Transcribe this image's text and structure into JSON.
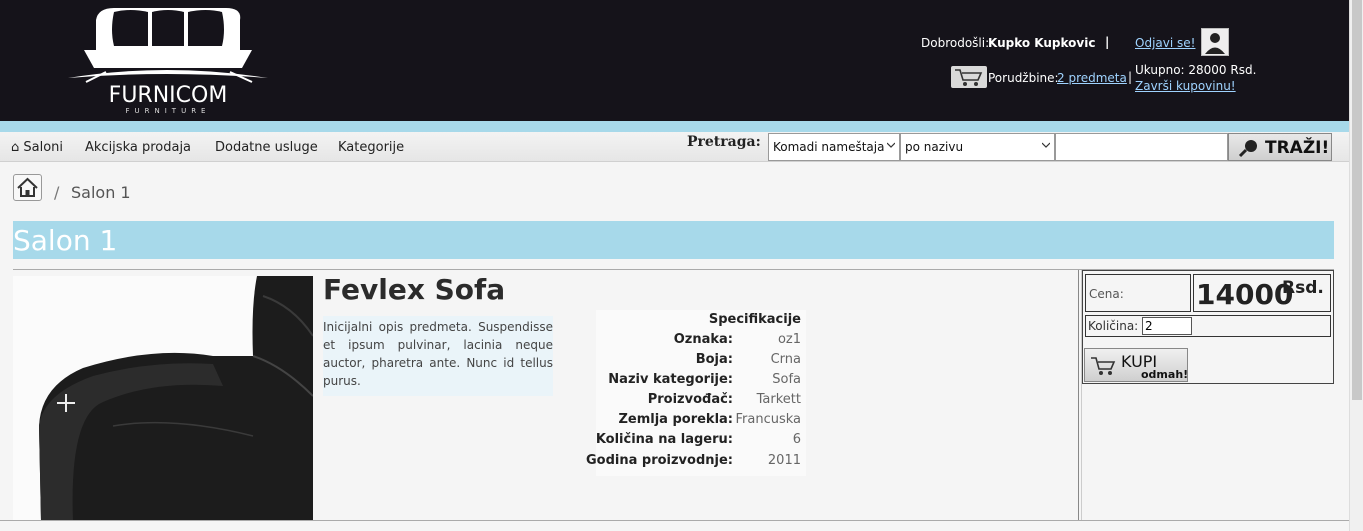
{
  "header": {
    "logo": {
      "brand": "FURNICOM",
      "tagline": "FURNITURE"
    },
    "welcome_label": "Dobrodošli:",
    "user_name": "Kupko Kupkovic",
    "separator": "|",
    "logout_link": "Odjavi se!",
    "orders_label": "Porudžbine:",
    "orders_link": "2 predmeta",
    "total_label": "Ukupno: 28000 Rsd.",
    "checkout_link": "Završi kupovinu!",
    "icons": {
      "avatar": "user-avatar-icon",
      "cart": "shopping-cart-icon"
    }
  },
  "nav": {
    "items": [
      {
        "label": "⌂ Saloni"
      },
      {
        "label": "Akcijska prodaja"
      },
      {
        "label": "Dodatne usluge"
      },
      {
        "label": "Kategorije"
      }
    ],
    "search": {
      "label": "Pretraga:",
      "category_select": "Komadi nameštaja",
      "mode_select": "po nazivu",
      "query": "",
      "button_label": "TRAŽI!"
    }
  },
  "breadcrumb": {
    "separator": "/",
    "current": "Salon 1"
  },
  "salon": {
    "title": "Salon 1"
  },
  "product": {
    "name": "Fevlex Sofa",
    "description": "Inicijalni opis predmeta. Suspendisse et ipsum pulvinar, lacinia neque auctor, pharetra ante. Nunc id tellus purus.",
    "specs_title": "Specifikacije",
    "specs": [
      {
        "key": "Oznaka:",
        "value": "oz1"
      },
      {
        "key": "Boja:",
        "value": "Crna"
      },
      {
        "key": "Naziv kategorije:",
        "value": "Sofa"
      },
      {
        "key": "Proizvođač:",
        "value": "Tarkett"
      },
      {
        "key": "Zemlja porekla:",
        "value": "Francuska"
      },
      {
        "key": "Količina na lageru:",
        "value": "6"
      },
      {
        "key": "Godina proizvodnje:",
        "value": "2011"
      }
    ]
  },
  "buy": {
    "price_label": "Cena:",
    "price_value": "14000",
    "currency": "Rsd.",
    "quantity_label": "Količina:",
    "quantity_value": "2",
    "button_main": "KUPI",
    "button_sub": "odmah!"
  },
  "colors": {
    "header_bg": "#15131a",
    "accent_blue": "#a7d9ea",
    "link": "#9fd3ff"
  }
}
